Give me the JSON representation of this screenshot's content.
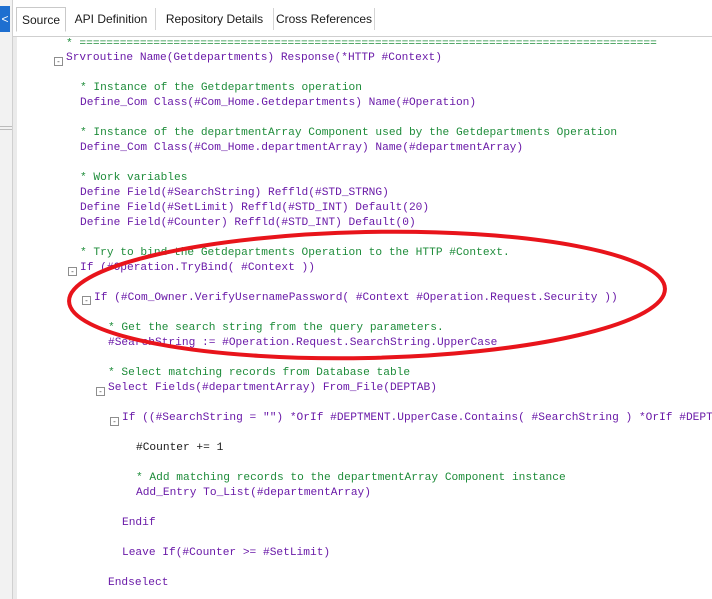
{
  "panel": {
    "collapse_icon": "chevron-left-icon",
    "collapse_glyph": "<"
  },
  "tabs": [
    {
      "label": "Source",
      "active": true
    },
    {
      "label": "API Definition",
      "active": false
    },
    {
      "label": "Repository Details",
      "active": false
    },
    {
      "label": "Cross References",
      "active": false
    }
  ],
  "editor": {
    "fold_marker": "-",
    "lines": [
      [
        [
          "cm",
          "* ======================================================================================"
        ]
      ],
      [
        [
          "kw",
          "Srvroutine Name(Getdepartments) Response(*HTTP #Context)"
        ]
      ],
      [
        [
          "cm",
          "* Instance of the Getdepartments operation"
        ]
      ],
      [
        [
          "kw",
          "Define_Com Class(#Com_Home.Getdepartments) Name(#Operation)"
        ]
      ],
      [
        [
          "cm",
          "* Instance of the departmentArray Component used by the Getdepartments Operation"
        ]
      ],
      [
        [
          "kw",
          "Define_Com Class(#Com_Home.departmentArray) Name(#departmentArray)"
        ]
      ],
      [
        [
          "cm",
          "* Work variables"
        ]
      ],
      [
        [
          "kw",
          "Define Field(#SearchString) Reffld(#STD_STRNG)"
        ]
      ],
      [
        [
          "kw",
          "Define Field(#SetLimit) Reffld(#STD_INT) Default(20)"
        ]
      ],
      [
        [
          "kw",
          "Define Field(#Counter) Reffld(#STD_INT) Default(0)"
        ]
      ],
      [
        [
          "cm",
          "* Try to bind the Getdepartments Operation to the HTTP #Context."
        ]
      ],
      [
        [
          "kw",
          "If (#Operation.TryBind( #Context ))"
        ]
      ],
      [
        [
          "kw",
          "If (#Com_Owner.VerifyUsernamePassword( #Context #Operation.Request.Security ))"
        ]
      ],
      [
        [
          "cm",
          "* Get the search string from the query parameters."
        ]
      ],
      [
        [
          "kw",
          "#SearchString := #Operation.Request.SearchString.UpperCase"
        ]
      ],
      [
        [
          "cm",
          "* Select matching records from Database table"
        ]
      ],
      [
        [
          "kw",
          "Select Fields(#departmentArray) From_File(DEPTAB)"
        ]
      ],
      [
        [
          "kw",
          "If ((#SearchString = \"\") *OrIf #DEPTMENT.UpperCase.Contains( #SearchString ) *OrIf #DEPTDESC.UpperCase.Contains( #SearchString ))"
        ]
      ],
      [
        [
          "pl",
          "#Counter += 1"
        ]
      ],
      [
        [
          "cm",
          "* Add matching records to the departmentArray Component instance"
        ]
      ],
      [
        [
          "kw",
          "Add_Entry To_List(#departmentArray)"
        ]
      ],
      [
        [
          "kw",
          "Endif"
        ]
      ],
      [
        [
          "kw",
          "Leave If(#Counter >= #SetLimit)"
        ]
      ],
      [
        [
          "kw",
          "Endselect"
        ]
      ]
    ]
  },
  "annotation": {
    "color": "#e8141b",
    "shape": "ellipse"
  }
}
